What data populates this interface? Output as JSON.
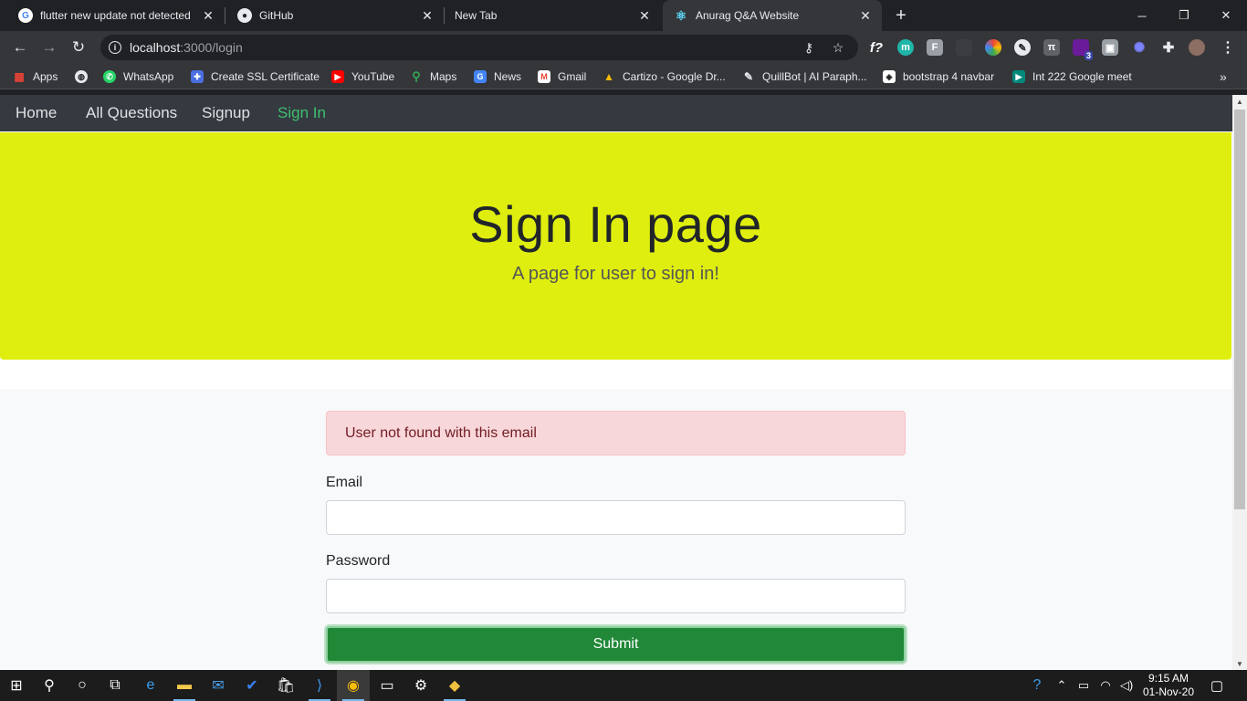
{
  "browser": {
    "tabs": [
      {
        "title": "flutter new update not detected",
        "favicon": "google-icon",
        "active": false
      },
      {
        "title": "GitHub",
        "favicon": "github-icon",
        "active": false
      },
      {
        "title": "New Tab",
        "favicon": "",
        "active": false
      },
      {
        "title": "Anurag Q&A Website",
        "favicon": "react-icon",
        "active": true
      }
    ],
    "url_host": "localhost",
    "url_path": ":3000/login",
    "bookmarks": [
      {
        "label": "Apps",
        "icon": "apps-grid-icon"
      },
      {
        "label": "",
        "icon": "globe-icon"
      },
      {
        "label": "WhatsApp",
        "icon": "whatsapp-icon"
      },
      {
        "label": "Create SSL Certificate",
        "icon": "puzzle-icon"
      },
      {
        "label": "YouTube",
        "icon": "youtube-icon"
      },
      {
        "label": "Maps",
        "icon": "maps-icon"
      },
      {
        "label": "News",
        "icon": "news-icon"
      },
      {
        "label": "Gmail",
        "icon": "gmail-icon"
      },
      {
        "label": "Cartizo - Google Dr...",
        "icon": "drive-icon"
      },
      {
        "label": "QuillBot | AI Paraph...",
        "icon": "quill-icon"
      },
      {
        "label": "bootstrap 4 navbar",
        "icon": "codepen-icon"
      },
      {
        "label": "Int 222 Google meet",
        "icon": "meet-icon"
      }
    ],
    "extension_badge": "3"
  },
  "site": {
    "nav": {
      "home": "Home",
      "all_questions": "All Questions",
      "signup": "Signup",
      "sign_in": "Sign In"
    },
    "jumbotron": {
      "title": "Sign In page",
      "subtitle": "A page for user to sign in!",
      "background_color": "#dfee0e"
    },
    "form": {
      "alert": "User not found with this email",
      "email_label": "Email",
      "email_value": "",
      "password_label": "Password",
      "password_value": "",
      "submit_label": "Submit"
    }
  },
  "taskbar": {
    "time": "9:15 AM",
    "date": "01-Nov-20"
  },
  "colors": {
    "nav_active": "#3fbf6f",
    "alert_bg": "#f8d7da",
    "submit_bg": "#218838"
  }
}
